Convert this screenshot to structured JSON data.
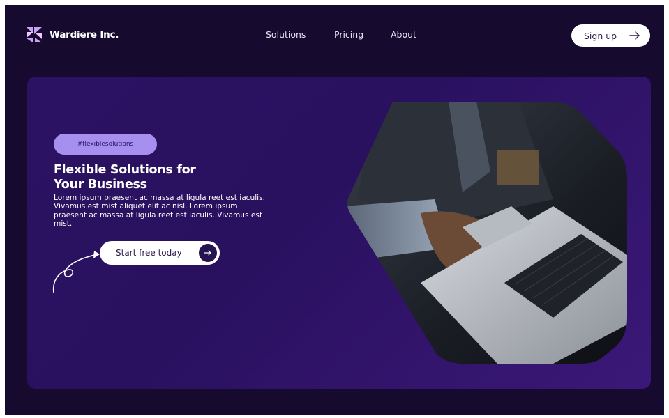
{
  "brand": {
    "name": "Wardiere Inc.",
    "logo_icon": "brand-logo-icon"
  },
  "nav": {
    "items": [
      {
        "label": "Solutions"
      },
      {
        "label": "Pricing"
      },
      {
        "label": "About"
      }
    ],
    "signup_label": "Sign up",
    "signup_icon": "arrow-right-icon"
  },
  "hero": {
    "tag": "#flexiblesolutions",
    "title_line1": "Flexible Solutions for",
    "title_line2": "Your Business",
    "body": "Lorem ipsum praesent ac massa at ligula reet est iaculis. Vivamus est mist aliquet elit ac nisl. Lorem ipsum praesent ac massa at ligula reet est iaculis. Vivamus est mist.",
    "cta_label": "Start free today",
    "cta_icon": "arrow-right-icon",
    "image": "person-typing-on-laptop-photo"
  },
  "colors": {
    "page_bg": "#160a2f",
    "hero_bg": "#2b1262",
    "tag_bg": "#a78ff0",
    "button_bg": "#ffffff",
    "cta_icon_bg": "#261452"
  }
}
